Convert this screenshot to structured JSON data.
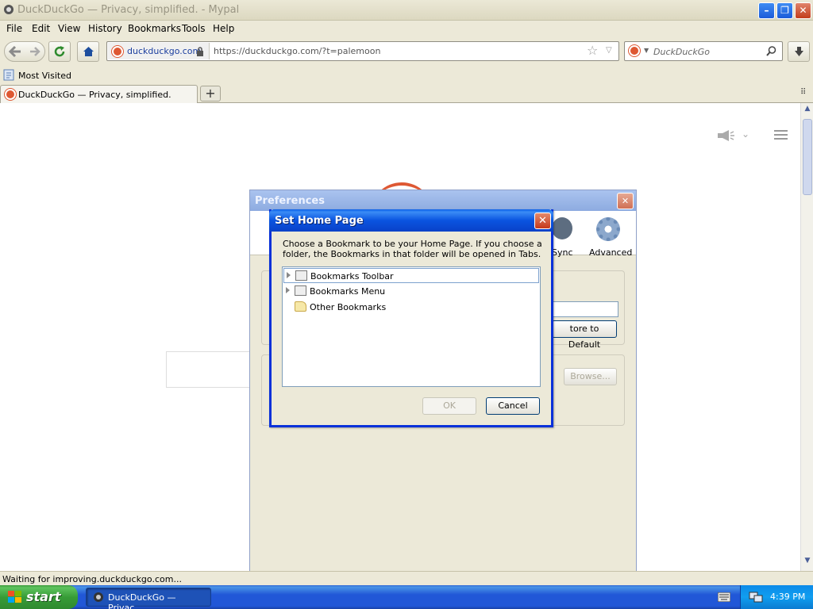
{
  "window": {
    "title": "DuckDuckGo — Privacy, simplified. - Mypal"
  },
  "menu": [
    "File",
    "Edit",
    "View",
    "History",
    "Bookmarks",
    "Tools",
    "Help"
  ],
  "navbar": {
    "identity_host": "duckduckgo.com",
    "url": "https://duckduckgo.com/?t=palemoon",
    "search_placeholder": "DuckDuckGo"
  },
  "bookmarks_toolbar": {
    "most_visited": "Most Visited"
  },
  "tabs": [
    {
      "label": "DuckDuckGo — Privacy, simplified."
    }
  ],
  "preferences": {
    "title": "Preferences",
    "tabs": {
      "sync": "Sync",
      "advanced": "Advanced"
    },
    "restore_default": "tore to Default",
    "browse": "Browse..."
  },
  "dialog": {
    "title": "Set Home Page",
    "description": "Choose a Bookmark to be your Home Page. If you choose a folder, the Bookmarks in that folder will be opened in Tabs.",
    "tree_items": [
      "Bookmarks Toolbar",
      "Bookmarks Menu",
      "Other Bookmarks"
    ],
    "ok_label": "OK",
    "cancel_label": "Cancel"
  },
  "status": {
    "text": "Waiting for improving.duckduckgo.com..."
  },
  "taskbar": {
    "start_label": "start",
    "task_label": "DuckDuckGo — Privac...",
    "clock": "4:39 PM"
  }
}
